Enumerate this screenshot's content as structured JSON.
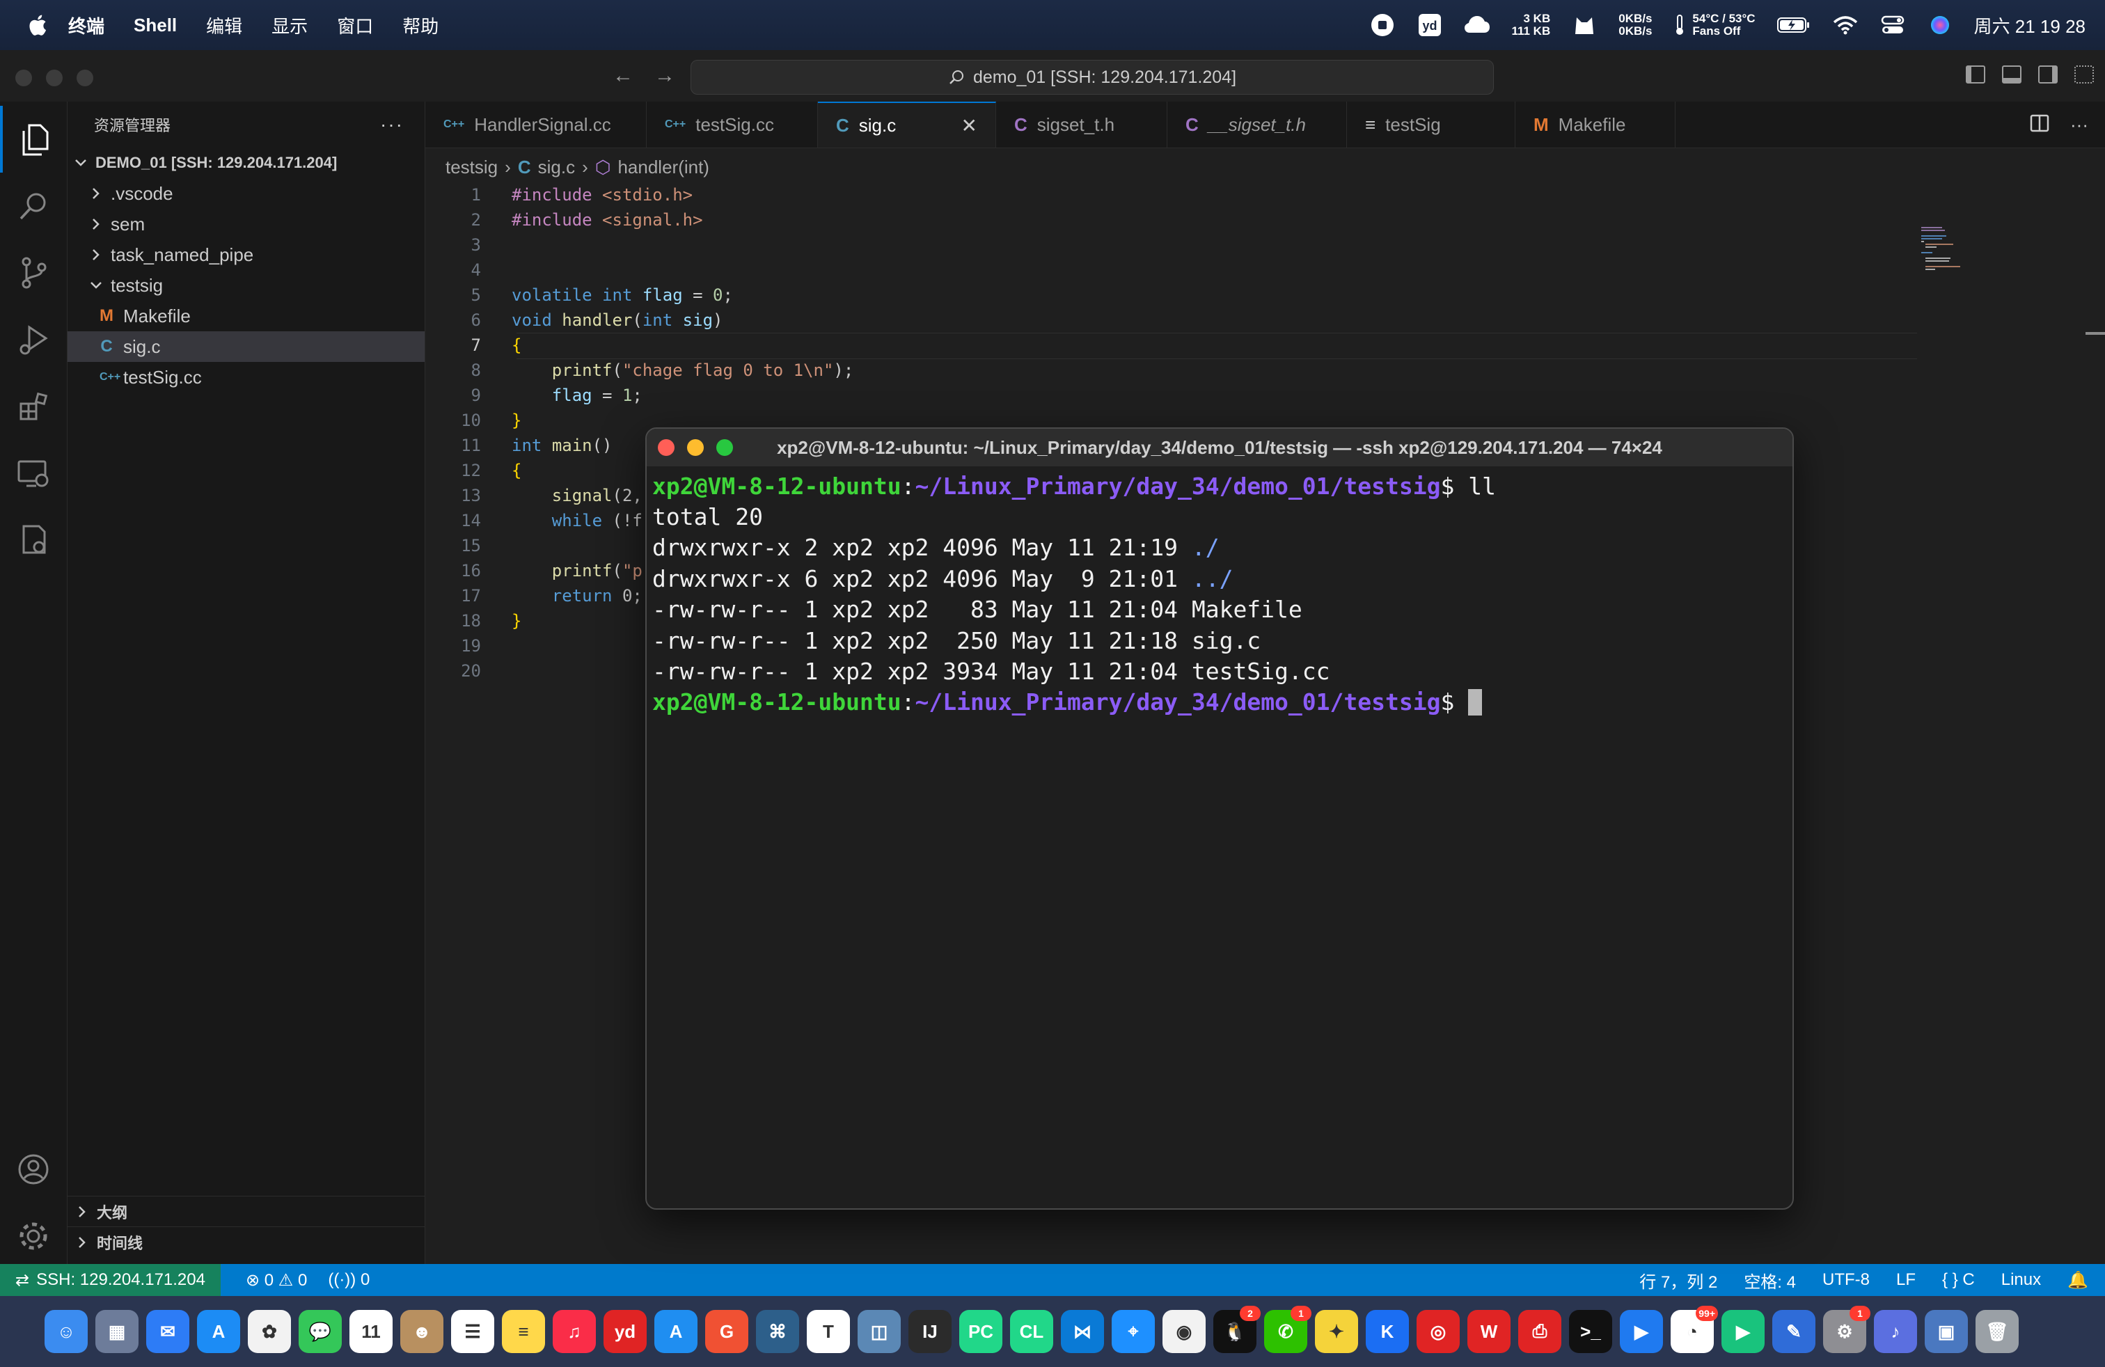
{
  "menubar": {
    "app_name": "终端",
    "items": [
      "Shell",
      "编辑",
      "显示",
      "窗口",
      "帮助"
    ],
    "net_up": "3 KB",
    "net_down": "111 KB",
    "disk_read": "0KB/s",
    "disk_write": "0KB/s",
    "temp": "54°C / 53°C",
    "fans": "Fans Off",
    "datetime": "周六 21 19 28"
  },
  "vscode": {
    "command_center": "demo_01 [SSH: 129.204.171.204]",
    "explorer_title": "资源管理器",
    "workspace": "DEMO_01 [SSH: 129.204.171.204]",
    "tree": [
      {
        "label": ".vscode",
        "type": "folder",
        "expanded": false,
        "depth": 1
      },
      {
        "label": "sem",
        "type": "folder",
        "expanded": false,
        "depth": 1
      },
      {
        "label": "task_named_pipe",
        "type": "folder",
        "expanded": false,
        "depth": 1
      },
      {
        "label": "testsig",
        "type": "folder",
        "expanded": true,
        "depth": 1
      },
      {
        "label": "Makefile",
        "type": "file",
        "icon": "M",
        "depth": 2
      },
      {
        "label": "sig.c",
        "type": "file",
        "icon": "C",
        "depth": 2,
        "selected": true
      },
      {
        "label": "testSig.cc",
        "type": "file",
        "icon": "C++",
        "depth": 2
      }
    ],
    "outline_label": "大纲",
    "timeline_label": "时间线",
    "tabs": [
      {
        "label": "HandlerSignal.cc",
        "icon": "C++"
      },
      {
        "label": "testSig.cc",
        "icon": "C++"
      },
      {
        "label": "sig.c",
        "icon": "C",
        "active": true
      },
      {
        "label": "sigset_t.h",
        "icon": "C"
      },
      {
        "label": "__sigset_t.h",
        "icon": "C"
      },
      {
        "label": "testSig",
        "icon": "≡"
      },
      {
        "label": "Makefile",
        "icon": "M"
      }
    ],
    "breadcrumb": [
      "testsig",
      "sig.c",
      "handler(int)"
    ],
    "status": {
      "remote": "SSH: 129.204.171.204",
      "errors": "0",
      "warnings": "0",
      "ports": "0",
      "position": "行 7，列 2",
      "spaces": "空格: 4",
      "encoding": "UTF-8",
      "eol": "LF",
      "language": "C",
      "platform": "Linux"
    }
  },
  "code_lines": [
    "#include <stdio.h>",
    "#include <signal.h>",
    "",
    "",
    "volatile int flag = 0;",
    "void handler(int sig)",
    "{",
    "    printf(\"chage flag 0 to 1\\n\");",
    "    flag = 1;",
    "}",
    "int main()",
    "{",
    "    signal(2,",
    "    while (!f",
    "",
    "    printf(\"p",
    "    return 0;",
    "}",
    "",
    ""
  ],
  "terminal": {
    "title": "xp2@VM-8-12-ubuntu: ~/Linux_Primary/day_34/demo_01/testsig — -ssh xp2@129.204.171.204 — 74×24",
    "prompt_user": "xp2@VM-8-12-ubuntu",
    "prompt_path": "~/Linux_Primary/day_34/demo_01/testsig",
    "command": "ll",
    "lines": [
      "total 20",
      "drwxrwxr-x 2 xp2 xp2 4096 May 11 21:19 ./",
      "drwxrwxr-x 6 xp2 xp2 4096 May  9 21:01 ../",
      "-rw-rw-r-- 1 xp2 xp2   83 May 11 21:04 Makefile",
      "-rw-rw-r-- 1 xp2 xp2  250 May 11 21:18 sig.c",
      "-rw-rw-r-- 1 xp2 xp2 3934 May 11 21:04 testSig.cc"
    ]
  },
  "dock": {
    "apps": [
      {
        "name": "finder-icon",
        "color": "#3b8cf0",
        "glyph": "☺"
      },
      {
        "name": "launchpad-icon",
        "color": "#6d7c9a",
        "glyph": "▦"
      },
      {
        "name": "mail-icon",
        "color": "#2d7cf6",
        "glyph": "✉"
      },
      {
        "name": "appstore-icon",
        "color": "#1c8cf5",
        "glyph": "A"
      },
      {
        "name": "photos-icon",
        "color": "#f2f2f2",
        "glyph": "✿"
      },
      {
        "name": "messages-icon",
        "color": "#34c759",
        "glyph": "💬"
      },
      {
        "name": "calendar-icon",
        "color": "#ffffff",
        "glyph": "11"
      },
      {
        "name": "contacts-icon",
        "color": "#b89060",
        "glyph": "☻"
      },
      {
        "name": "reminders-icon",
        "color": "#ffffff",
        "glyph": "☰"
      },
      {
        "name": "notes-icon",
        "color": "#ffd84a",
        "glyph": "≡"
      },
      {
        "name": "music-icon",
        "color": "#fa2d48",
        "glyph": "♫"
      },
      {
        "name": "youdao-icon",
        "color": "#e02424",
        "glyph": "yd"
      },
      {
        "name": "xcode-icon",
        "color": "#1f8ef1",
        "glyph": "A"
      },
      {
        "name": "git-icon",
        "color": "#f05133",
        "glyph": "G"
      },
      {
        "name": "ssh-icon",
        "color": "#2d5f8a",
        "glyph": "⌘"
      },
      {
        "name": "typora-icon",
        "color": "#ffffff",
        "glyph": "T"
      },
      {
        "name": "preview-icon",
        "color": "#5b88b5",
        "glyph": "◫"
      },
      {
        "name": "intellij-icon",
        "color": "#2b2b2b",
        "glyph": "IJ"
      },
      {
        "name": "pycharm-icon",
        "color": "#21d789",
        "glyph": "PC"
      },
      {
        "name": "clion-icon",
        "color": "#21d789",
        "glyph": "CL"
      },
      {
        "name": "vscode-icon",
        "color": "#0a7ad6",
        "glyph": "⋈"
      },
      {
        "name": "safari-icon",
        "color": "#1e90ff",
        "glyph": "⌖"
      },
      {
        "name": "chrome-icon",
        "color": "#f2f2f2",
        "glyph": "◉"
      },
      {
        "name": "qq-icon",
        "color": "#111111",
        "glyph": "🐧",
        "badge": "2"
      },
      {
        "name": "wechat-icon",
        "color": "#2dc100",
        "glyph": "✆",
        "badge": "1"
      },
      {
        "name": "maps-icon",
        "color": "#f5d33a",
        "glyph": "✦"
      },
      {
        "name": "kugou-icon",
        "color": "#1b6ef3",
        "glyph": "K"
      },
      {
        "name": "netease-music-icon",
        "color": "#e02424",
        "glyph": "◎"
      },
      {
        "name": "wps-icon",
        "color": "#e02424",
        "glyph": "W"
      },
      {
        "name": "pdf-icon",
        "color": "#e02424",
        "glyph": "⎙"
      },
      {
        "name": "terminal-icon",
        "color": "#111111",
        "glyph": ">_"
      },
      {
        "name": "infuse-icon",
        "color": "#1f7af0",
        "glyph": "▶"
      },
      {
        "name": "screenshot-icon",
        "color": "#ffffff",
        "glyph": "◔",
        "badge": "99+"
      },
      {
        "name": "player-icon",
        "color": "#19c37d",
        "glyph": "▶"
      },
      {
        "name": "xcode-tools-icon",
        "color": "#2f6cd8",
        "glyph": "✎"
      },
      {
        "name": "system-settings-icon",
        "color": "#8e8e93",
        "glyph": "⚙",
        "badge": "1"
      },
      {
        "name": "downloads-icon",
        "color": "#5b6fe0",
        "glyph": "♪"
      },
      {
        "name": "screen-icon",
        "color": "#4a78c0",
        "glyph": "▣"
      },
      {
        "name": "trash-icon",
        "color": "#9aa0a6",
        "glyph": "🗑"
      }
    ]
  }
}
